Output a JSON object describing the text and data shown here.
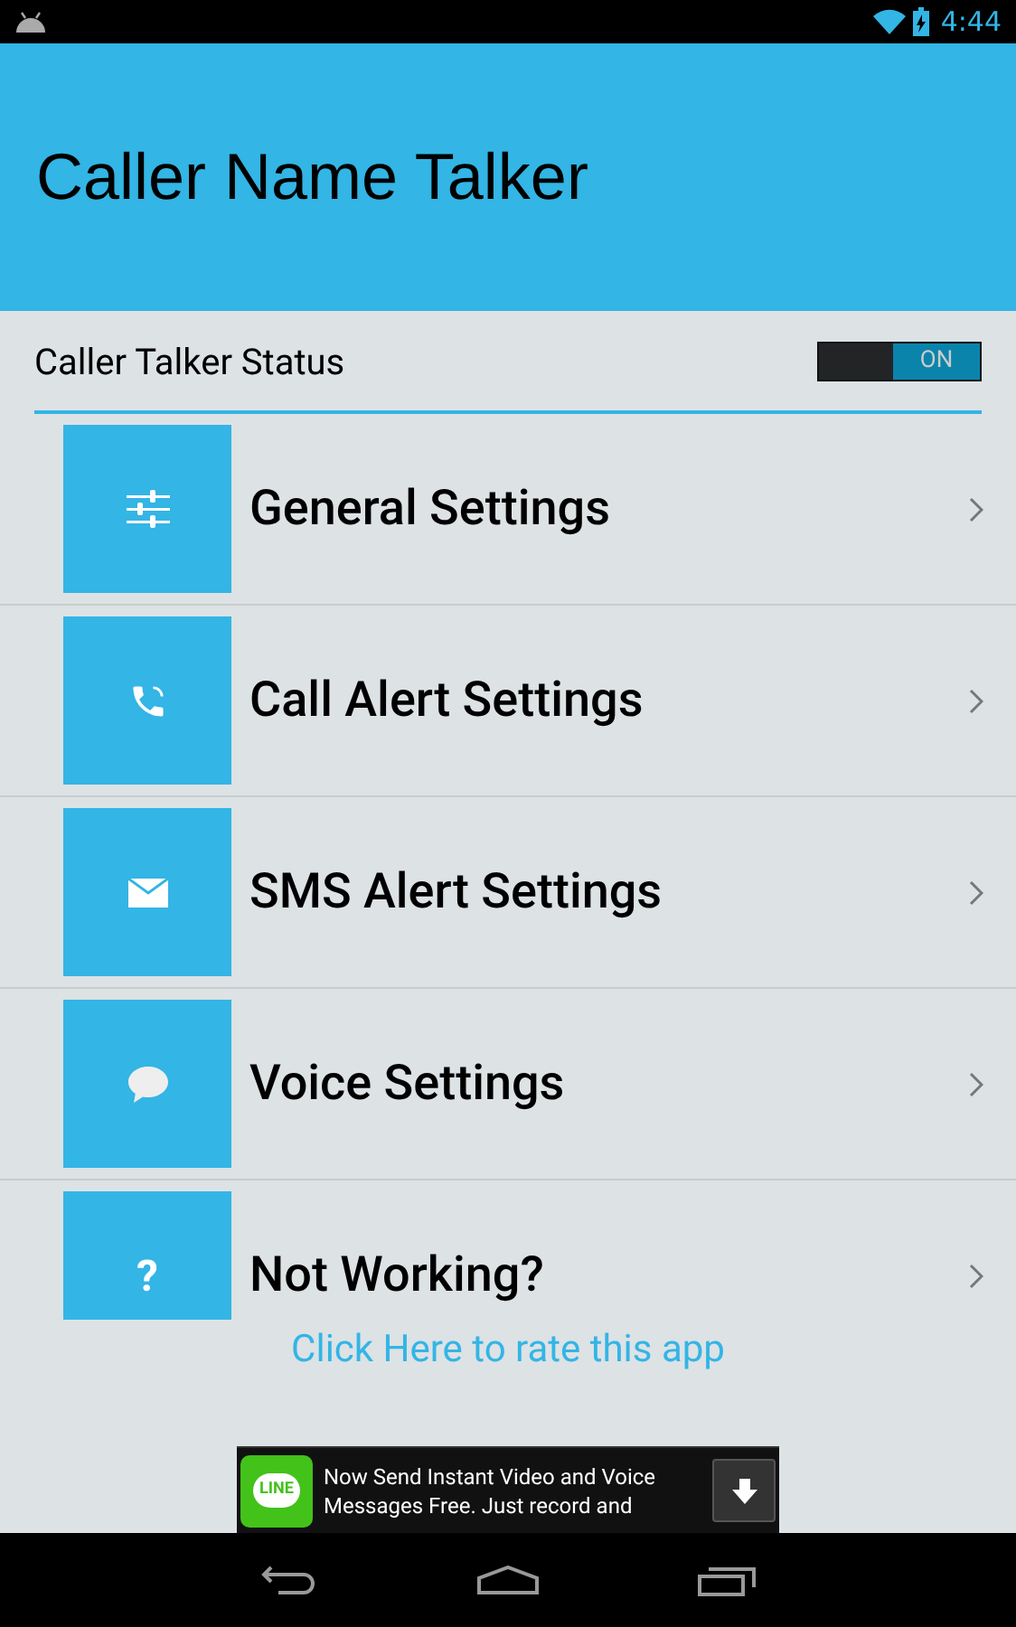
{
  "status_bar": {
    "time": "4:44"
  },
  "header": {
    "title": "Caller Name Talker"
  },
  "status_row": {
    "label": "Caller Talker Status",
    "switch_label": "ON",
    "on": true
  },
  "menu": [
    {
      "kind": "sliders",
      "label": "General Settings"
    },
    {
      "kind": "phone",
      "label": "Call Alert Settings"
    },
    {
      "kind": "mail",
      "label": "SMS Alert Settings"
    },
    {
      "kind": "chat",
      "label": "Voice Settings"
    },
    {
      "kind": "help",
      "glyph": "?",
      "label": "Not Working?"
    }
  ],
  "rate_link": "Click Here to rate this app",
  "ad": {
    "logo": "LINE",
    "text": "Now Send Instant Video and Voice Messages Free. Just record and"
  }
}
